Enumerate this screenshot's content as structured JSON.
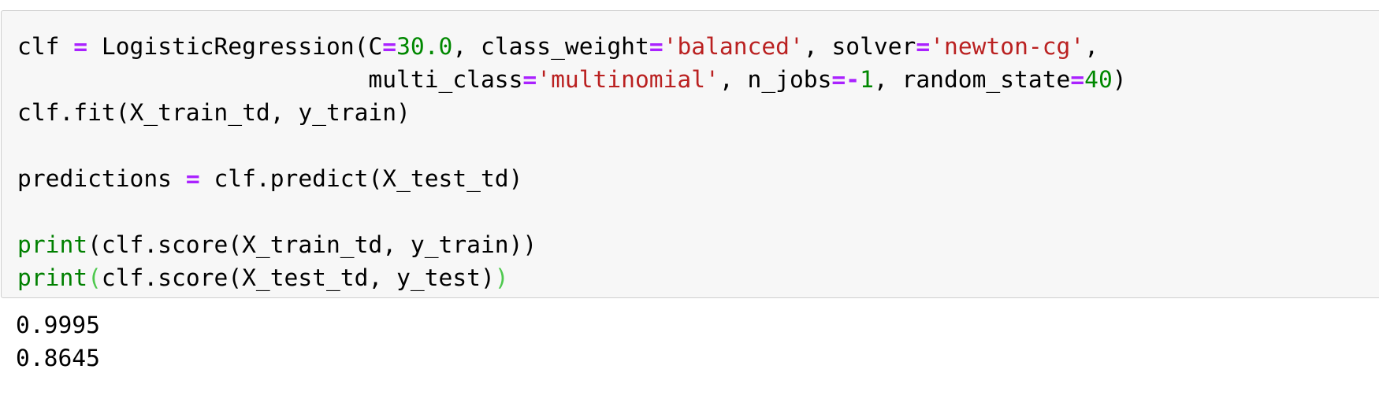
{
  "code": {
    "l1": {
      "a": "clf ",
      "b": "=",
      "c": " LogisticRegression(C",
      "d": "=",
      "e": "30.0",
      "f": ", class_weight",
      "g": "=",
      "h": "'balanced'",
      "i": ", solver",
      "j": "=",
      "k": "'newton-cg'",
      "l": ","
    },
    "l2": {
      "a": "                         multi_class",
      "b": "=",
      "c": "'multinomial'",
      "d": ", n_jobs",
      "e": "=-",
      "f": "1",
      "g": ", random_state",
      "h": "=",
      "i": "40",
      "j": ")"
    },
    "l3": "clf.fit(X_train_td, y_train)",
    "l5": {
      "a": "predictions ",
      "b": "=",
      "c": " clf.predict(X_test_td)"
    },
    "l7": {
      "a": "print",
      "b": "(clf.score(X_train_td, y_train))"
    },
    "l8": {
      "a": "print",
      "b": "(",
      "c": "clf.score(X_test_td, y_test)",
      "d": ")"
    }
  },
  "output": {
    "line1": "0.9995",
    "line2": "0.8645"
  }
}
